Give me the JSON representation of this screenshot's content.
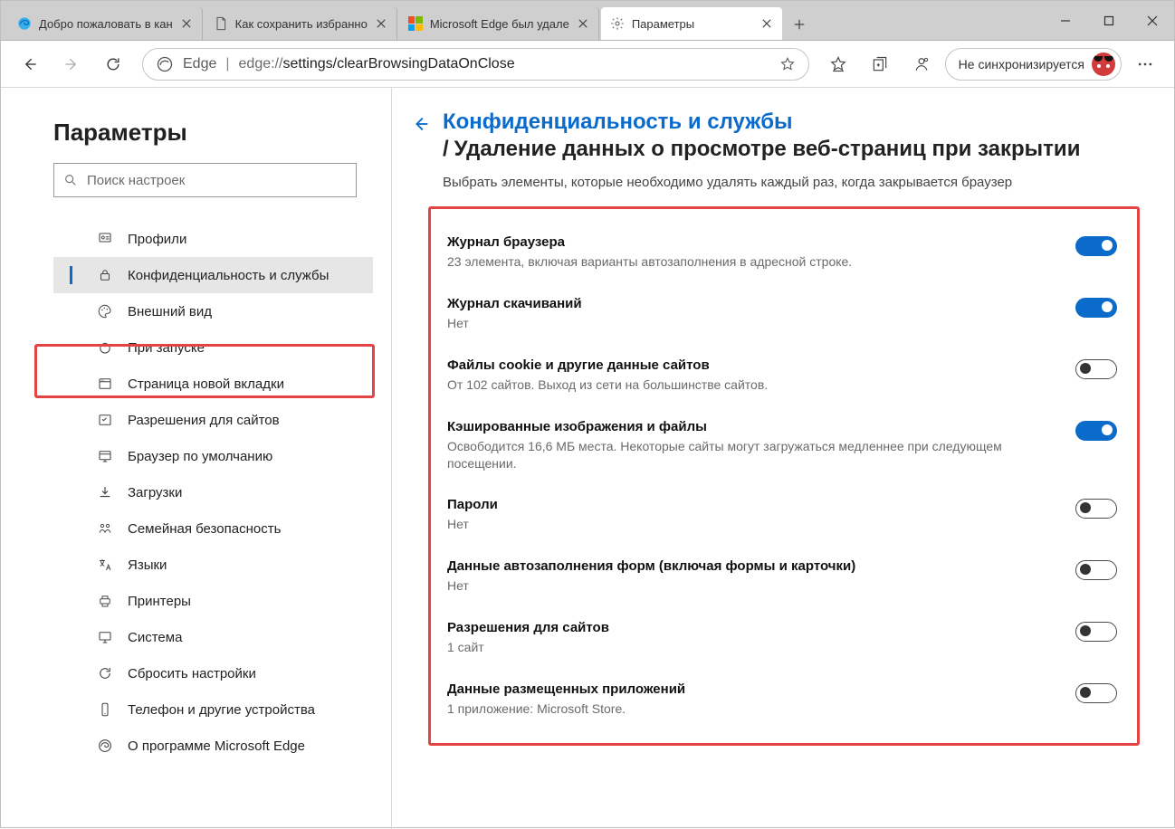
{
  "tabs": [
    {
      "title": "Добро пожаловать в кан"
    },
    {
      "title": "Как сохранить избранно"
    },
    {
      "title": "Microsoft Edge был удале"
    },
    {
      "title": "Параметры"
    }
  ],
  "address": {
    "product": "Edge",
    "scheme": "edge://",
    "path_plain_prefix": "settings/",
    "path_bold": "clearBrowsingDataOnClose"
  },
  "sync_label": "Не синхронизируется",
  "sidebar": {
    "title": "Параметры",
    "search_placeholder": "Поиск настроек",
    "items": [
      "Профили",
      "Конфиденциальность и службы",
      "Внешний вид",
      "При запуске",
      "Страница новой вкладки",
      "Разрешения для сайтов",
      "Браузер по умолчанию",
      "Загрузки",
      "Семейная безопасность",
      "Языки",
      "Принтеры",
      "Система",
      "Сбросить настройки",
      "Телефон и другие устройства",
      "О программе Microsoft Edge"
    ]
  },
  "breadcrumb": {
    "parent": "Конфиденциальность и службы",
    "current": "Удаление данных о просмотре веб-страниц при закрытии"
  },
  "description": "Выбрать элементы, которые необходимо удалять каждый раз, когда закрывается браузер",
  "settings": [
    {
      "title": "Журнал браузера",
      "sub": "23 элемента, включая варианты автозаполнения в адресной строке.",
      "on": true
    },
    {
      "title": "Журнал скачиваний",
      "sub": "Нет",
      "on": true
    },
    {
      "title": "Файлы cookie и другие данные сайтов",
      "sub": "От 102 сайтов. Выход из сети на большинстве сайтов.",
      "on": false
    },
    {
      "title": "Кэшированные изображения и файлы",
      "sub": "Освободится 16,6 МБ места. Некоторые сайты могут загружаться медленнее при следующем посещении.",
      "on": true
    },
    {
      "title": "Пароли",
      "sub": "Нет",
      "on": false
    },
    {
      "title": "Данные автозаполнения форм (включая формы и карточки)",
      "sub": "Нет",
      "on": false
    },
    {
      "title": "Разрешения для сайтов",
      "sub": "1 сайт",
      "on": false
    },
    {
      "title": "Данные размещенных приложений",
      "sub": "1 приложение: Microsoft Store.",
      "on": false
    }
  ]
}
